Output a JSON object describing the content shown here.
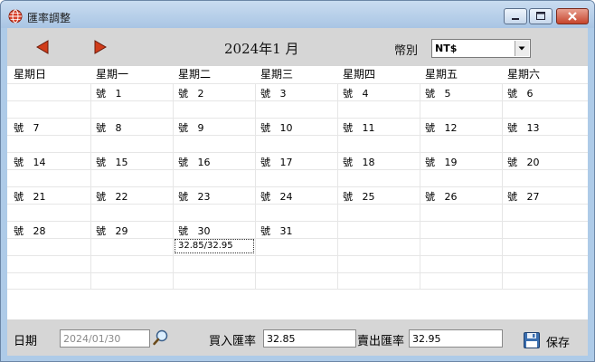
{
  "window": {
    "title": "匯率調整"
  },
  "toolbar": {
    "month_label": "2024年1 月",
    "currency_label": "幣別",
    "currency_value": "NT$"
  },
  "weekdays": [
    "星期日",
    "星期一",
    "星期二",
    "星期三",
    "星期四",
    "星期五",
    "星期六"
  ],
  "days": [
    [
      "",
      "號   1",
      "號   2",
      "號   3",
      "號   4",
      "號   5",
      "號   6"
    ],
    [
      "號   7",
      "號   8",
      "號   9",
      "號   10",
      "號   11",
      "號   12",
      "號   13"
    ],
    [
      "號   14",
      "號   15",
      "號   16",
      "號   17",
      "號   18",
      "號   19",
      "號   20"
    ],
    [
      "號   21",
      "號   22",
      "號   23",
      "號   24",
      "號   25",
      "號   26",
      "號   27"
    ],
    [
      "號   28",
      "號   29",
      "號   30",
      "號   31",
      "",
      "",
      ""
    ]
  ],
  "rate_entry": "32.85/32.95",
  "bottom": {
    "date_label": "日期",
    "date_value": "2024/01/30",
    "buy_label": "買入匯率",
    "buy_value": "32.85",
    "sell_label": "賣出匯率",
    "sell_value": "32.95",
    "save_label": "保存"
  },
  "colors": {
    "toolbar_bg": "#d6d6d6",
    "window_frame": "#aecbe8",
    "close_button": "#c7452d",
    "nav_arrow": "#d03c1a"
  }
}
